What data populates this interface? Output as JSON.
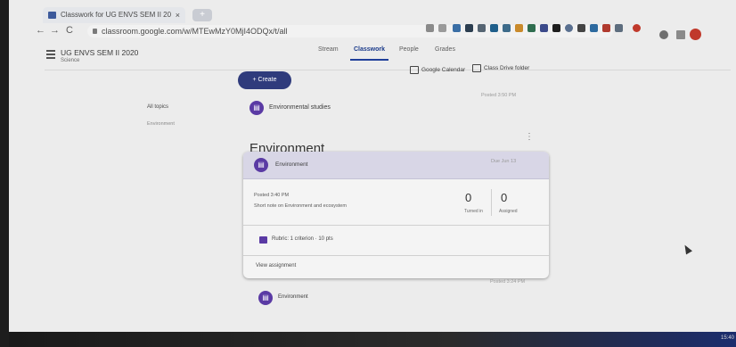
{
  "browser": {
    "tab_title": "Classwork for UG ENVS SEM II 20",
    "tab_close": "×",
    "new_tab": "+",
    "back": "←",
    "forward": "→",
    "reload": "C",
    "url": "classroom.google.com/w/MTEwMzY0MjI4ODQx/t/all"
  },
  "header": {
    "class_name": "UG ENVS SEM II 2020",
    "class_subject": "Science",
    "tabs": [
      {
        "label": "Stream"
      },
      {
        "label": "Classwork"
      },
      {
        "label": "People"
      },
      {
        "label": "Grades"
      }
    ]
  },
  "toolbar": {
    "create_label": "+ Create",
    "calendar_label": "Google Calendar",
    "drive_label": "Class Drive folder"
  },
  "sidebar": {
    "all_topics": "All topics",
    "topics": [
      "Environment"
    ]
  },
  "posts": [
    {
      "title": "Environmental studies",
      "meta": "Posted 3:50 PM"
    }
  ],
  "topic": {
    "title": "Environment",
    "kebab": "⋮"
  },
  "assignment": {
    "title": "Environment",
    "due": "Due Jun 13",
    "posted": "Posted 3:40 PM",
    "description": "Short note on Environment and ecosystem",
    "turned_in_count": "0",
    "turned_in_label": "Turned in",
    "assigned_count": "0",
    "assigned_label": "Assigned",
    "rubric": "Rubric: 1 criterion · 10 pts",
    "view_link": "View assignment"
  },
  "bottom_post": {
    "title": "Environment",
    "meta": "Posted 3:24 PM"
  },
  "taskbar": {
    "clock": "15:40"
  },
  "colors": {
    "accent": "#2f3b7c",
    "icon_purple": "#5a3aa4"
  }
}
